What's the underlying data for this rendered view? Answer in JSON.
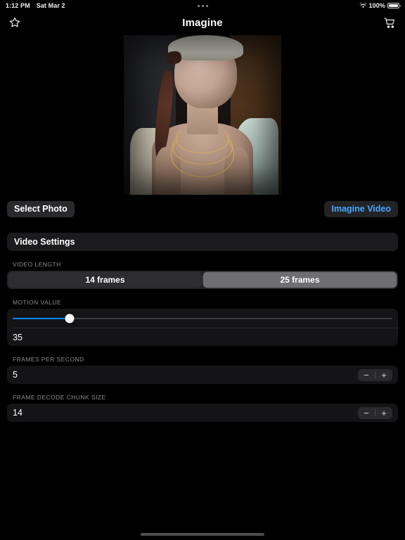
{
  "status_bar": {
    "time": "1:12 PM",
    "date": "Sat Mar 2",
    "battery_percent": "100%",
    "wifi_icon": "wifi-icon",
    "battery_icon": "battery-full-icon",
    "multitask_indicator": "•••"
  },
  "nav": {
    "title": "Imagine",
    "left_icon": "star-icon",
    "right_icon": "cart-icon"
  },
  "photo": {
    "alt": "portrait of woman with gold necklaces"
  },
  "actions": {
    "select_photo_label": "Select Photo",
    "imagine_video_label": "Imagine Video",
    "accent_color": "#47a6ff"
  },
  "settings": {
    "header": "Video Settings",
    "video_length": {
      "label": "VIDEO LENGTH",
      "options": [
        "14 frames",
        "25 frames"
      ],
      "selected": "25 frames",
      "selected_index": 1
    },
    "motion_value": {
      "label": "MOTION VALUE",
      "value": "35",
      "percent": 15,
      "fill_color": "#0a84ff"
    },
    "frames_per_second": {
      "label": "FRAMES PER SECOND",
      "value": "5",
      "decrement": "−",
      "increment": "+"
    },
    "frame_decode_chunk_size": {
      "label": "FRAME DECODE CHUNK SIZE",
      "value": "14",
      "decrement": "−",
      "increment": "+"
    }
  }
}
